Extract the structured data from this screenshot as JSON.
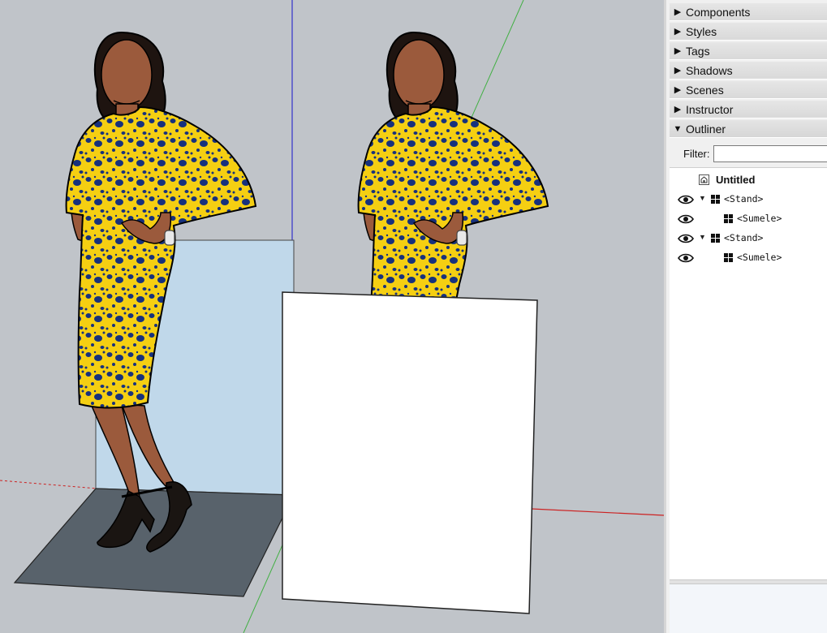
{
  "tray": {
    "panels": [
      {
        "label": "Components",
        "state": "collapsed"
      },
      {
        "label": "Styles",
        "state": "collapsed"
      },
      {
        "label": "Tags",
        "state": "collapsed"
      },
      {
        "label": "Shadows",
        "state": "collapsed"
      },
      {
        "label": "Scenes",
        "state": "collapsed"
      },
      {
        "label": "Instructor",
        "state": "collapsed"
      },
      {
        "label": "Outliner",
        "state": "expanded"
      }
    ],
    "outliner": {
      "filter_label": "Filter:",
      "filter_value": "",
      "tree": [
        {
          "label": "Untitled",
          "kind": "model",
          "visible": true
        },
        {
          "label": "<Stand>",
          "kind": "component",
          "expanded": true,
          "visible": true
        },
        {
          "label": "<Sumele>",
          "kind": "component",
          "visible": true
        },
        {
          "label": "<Stand>",
          "kind": "component",
          "expanded": true,
          "visible": true
        },
        {
          "label": "<Sumele>",
          "kind": "component",
          "visible": true
        }
      ]
    }
  },
  "icons": {
    "collapsed": "triangle-right-icon",
    "expanded": "triangle-down-icon",
    "visibility": "eye-icon",
    "component": "component-icon",
    "model": "house-icon"
  },
  "colors": {
    "viewport_bg": "#c0c4c9",
    "dress_yellow": "#f5cf12",
    "dress_dots": "#17317d",
    "skin": "#9b5a3c",
    "hair": "#1e1410",
    "stand_blue": "#c0d8ea",
    "floor": "#58626b",
    "white_board": "#ffffff",
    "axis_red": "#cc2222",
    "axis_green": "#22aa22",
    "axis_blue": "#2222cc"
  }
}
